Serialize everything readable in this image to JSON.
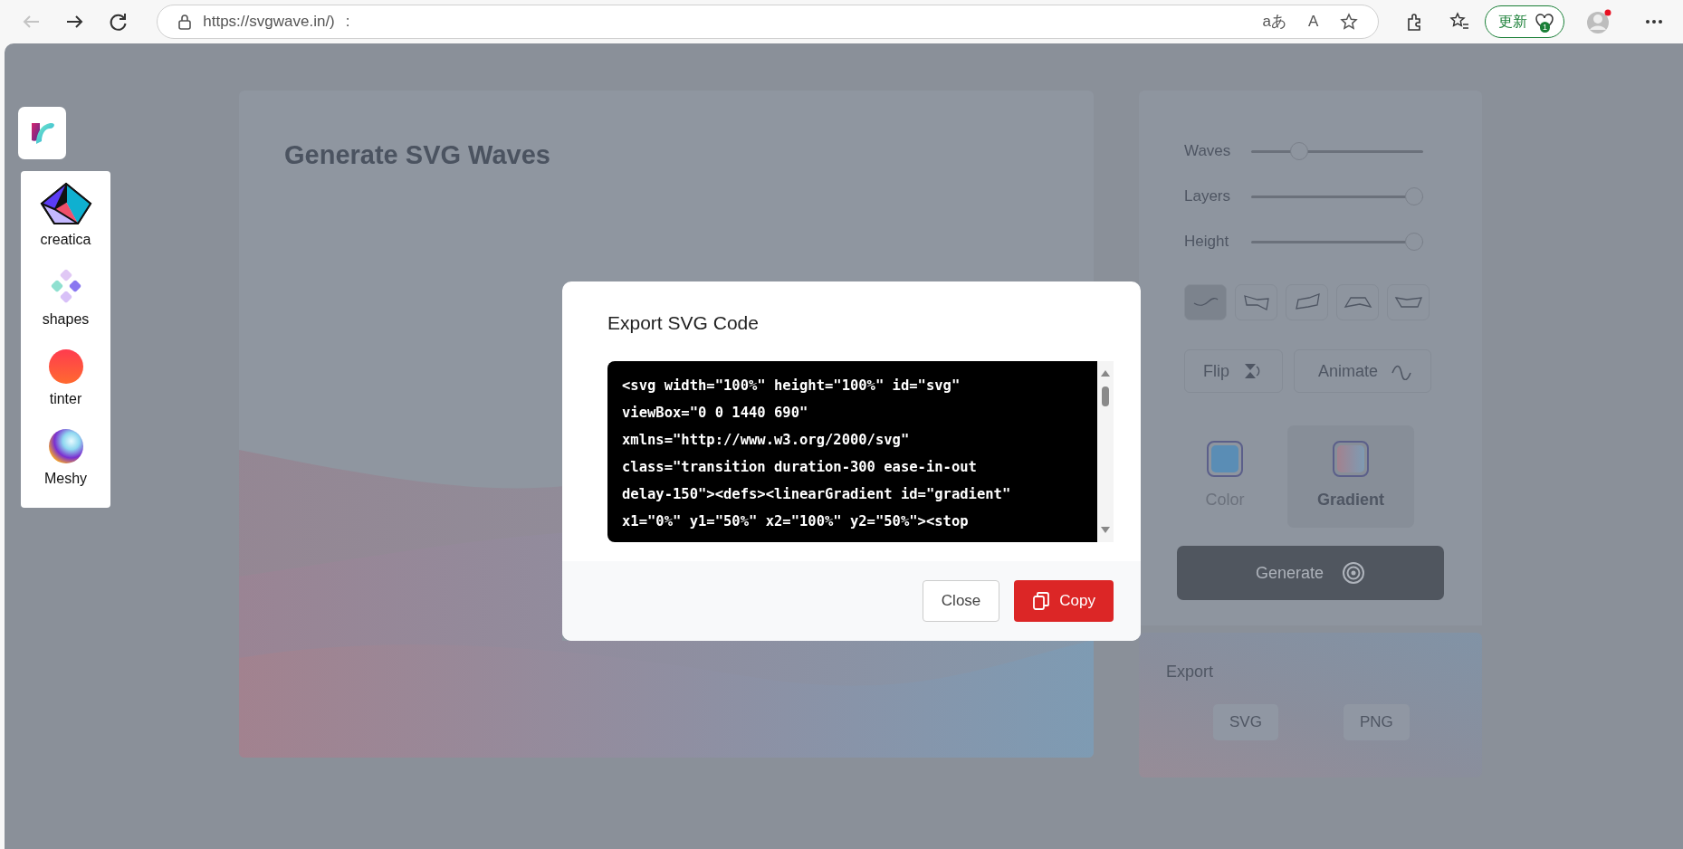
{
  "browser": {
    "nav": [
      {
        "kind": "back",
        "disabled": true
      },
      {
        "kind": "forward",
        "disabled": false
      },
      {
        "kind": "reload",
        "disabled": false
      }
    ],
    "url": "https://svgwave.in/)",
    "url_suffix": ":",
    "translate": "aあ",
    "read_aloud": "A",
    "update_button": {
      "label": "更新",
      "badge": "1"
    }
  },
  "sidebar": {
    "items": [
      {
        "label": "creatica",
        "kind": "cube"
      },
      {
        "label": "shapes",
        "kind": "dots"
      },
      {
        "label": "tinter",
        "kind": "circle"
      },
      {
        "label": "Meshy",
        "kind": "sphere"
      }
    ]
  },
  "main": {
    "title": "Generate SVG Waves"
  },
  "controls": {
    "sliders": [
      {
        "label": "Waves",
        "level": 0.25
      },
      {
        "label": "Layers",
        "level": 1
      },
      {
        "label": "Height",
        "level": 1
      }
    ],
    "shapes": [
      {
        "kind": "wave",
        "selected": true
      },
      {
        "kind": "left",
        "selected": false
      },
      {
        "kind": "right",
        "selected": false
      },
      {
        "kind": "arch",
        "selected": false
      },
      {
        "kind": "bowl",
        "selected": false
      }
    ],
    "toggles": [
      {
        "label": "Flip",
        "kind": "flip"
      },
      {
        "label": "Animate",
        "kind": "animate"
      }
    ],
    "fills": [
      {
        "label": "Color",
        "kind": "solid",
        "selected": false
      },
      {
        "label": "Gradient",
        "kind": "gradient",
        "selected": true
      }
    ],
    "generate": "Generate"
  },
  "export": {
    "title": "Export",
    "buttons": [
      "SVG",
      "PNG"
    ]
  },
  "modal": {
    "title": "Export SVG Code",
    "code": [
      "<svg width=\"100%\" height=\"100%\" id=\"svg\"",
      "viewBox=\"0 0 1440 690\"",
      "xmlns=\"http://www.w3.org/2000/svg\"",
      "class=\"transition duration-300 ease-in-out",
      "delay-150\"><defs><linearGradient id=\"gradient\"",
      "x1=\"0%\" y1=\"50%\" x2=\"100%\" y2=\"50%\"><stop"
    ],
    "close": "Close",
    "copy": "Copy"
  }
}
